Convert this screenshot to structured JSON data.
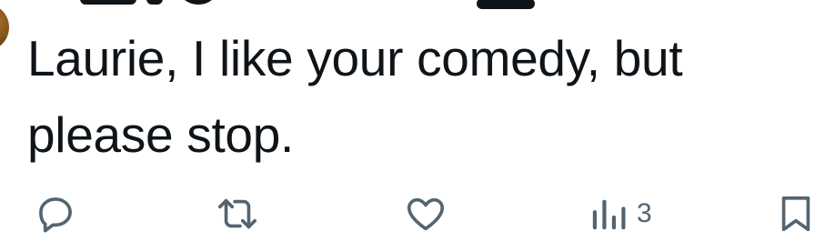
{
  "tweet": {
    "text": "Laurie, I like your comedy, but please stop."
  },
  "actions": {
    "reply": {
      "icon": "reply-icon",
      "count": ""
    },
    "repost": {
      "icon": "repost-icon",
      "count": ""
    },
    "like": {
      "icon": "heart-icon",
      "count": ""
    },
    "views": {
      "icon": "views-icon",
      "count": "3"
    },
    "bookmark": {
      "icon": "bookmark-icon",
      "count": ""
    }
  },
  "colors": {
    "text": "#0f1419",
    "icon": "#536471",
    "background": "#ffffff"
  }
}
